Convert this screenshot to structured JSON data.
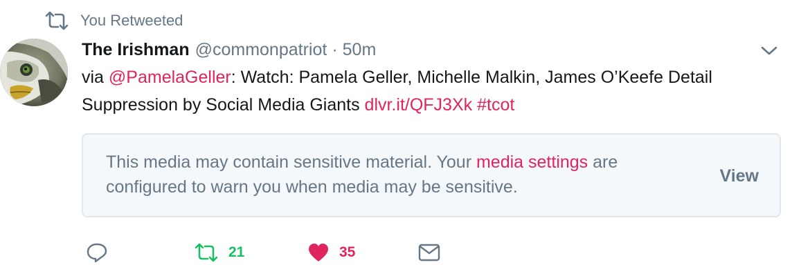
{
  "context": {
    "label": "You Retweeted",
    "icon": "retweet-icon"
  },
  "author": {
    "name": "The Irishman",
    "handle": "@commonpatriot",
    "separator": "·",
    "time": "50m",
    "avatar": "eagle-avatar"
  },
  "tweet": {
    "prefix": "via ",
    "mention": "@PamelaGeller",
    "body": ": Watch: Pamela Geller, Michelle Malkin, James O’Keefe Detail Suppression by Social Media Giants ",
    "link": "dlvr.it/QFJ3Xk",
    "space": " ",
    "hashtag": "#tcot"
  },
  "media_warning": {
    "text_before": "This media may contain sensitive material. Your ",
    "link": "media settings",
    "text_after": " are configured to warn you when media may be sensitive.",
    "view_label": "View"
  },
  "actions": {
    "reply_icon": "reply-icon",
    "retweet_icon": "retweet-icon",
    "retweet_count": "21",
    "like_icon": "heart-icon",
    "like_count": "35",
    "dm_icon": "envelope-icon"
  },
  "colors": {
    "link": "#e0245e",
    "retweet": "#17bf63",
    "like": "#e0245e",
    "muted": "#657786",
    "text": "#14171a"
  }
}
